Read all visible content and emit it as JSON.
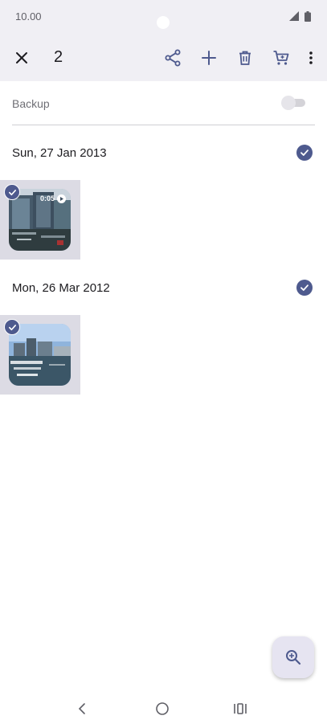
{
  "status_bar": {
    "time": "10.00"
  },
  "toolbar": {
    "selected_count": "2",
    "icons": [
      "close-icon",
      "share-icon",
      "add-icon",
      "delete-icon",
      "cart-icon",
      "more-vert-icon"
    ],
    "icon_color": "#4e5a8e"
  },
  "backup": {
    "label": "Backup",
    "enabled": false
  },
  "sections": [
    {
      "date": "Sun, 27 Jan 2013",
      "selected": true,
      "items": [
        {
          "type": "video",
          "duration": "0:05",
          "selected": true
        }
      ]
    },
    {
      "date": "Mon, 26 Mar 2012",
      "selected": true,
      "items": [
        {
          "type": "photo",
          "selected": true
        }
      ]
    }
  ],
  "fab": {
    "icon": "zoom-in-icon"
  },
  "nav": {
    "icons": [
      "back-icon",
      "home-icon",
      "recents-icon"
    ]
  },
  "colors": {
    "accent": "#4e5a8e",
    "toolbar_bg": "#f0eff4",
    "selected_tile_bg": "#dcdbe4"
  }
}
